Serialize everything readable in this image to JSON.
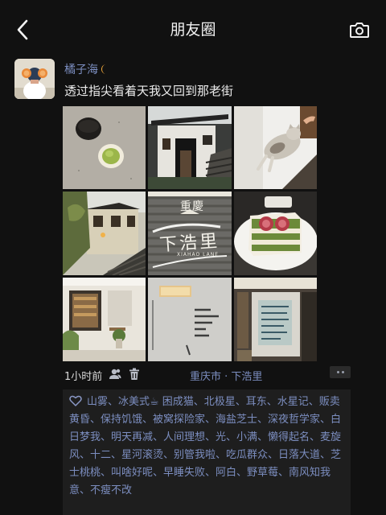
{
  "header": {
    "title": "朋友圈",
    "back_icon": "chevron-left-icon",
    "camera_icon": "camera-icon"
  },
  "post": {
    "username": "橘子海",
    "username_badge": "crescent-moon-icon",
    "text": "透过指尖看着天我又回到那老街",
    "photos": [
      "photo-stone-table-macarons",
      "photo-white-house-doorway",
      "photo-cat-on-wall",
      "photo-old-street-buildings",
      "photo-stairs-painted-sign",
      "photo-matcha-fig-cake",
      "photo-cafe-interior",
      "photo-poem-wall",
      "photo-handwritten-notice"
    ],
    "sign_text_top": "重慶",
    "sign_text_main": "下浩里",
    "sign_text_sub": "XIAHAO LANE",
    "time": "1小时前",
    "location": "重庆市 · 下浩里",
    "likes_text": "山雾、冰美式☕ 困成猫、北极星、耳东、水星记、贩卖黄昏、保持饥饿、被窝探险家、海盐芝士、深夜哲学家、白日梦我、明天再减、人间理想、光、小满、懒得起名、麦旋风、十二、星河滚烫、别管我啦、吃瓜群众、日落大道、芝士桃桃、叫啥好呢、早睡失败、阿白、野草莓、南风知我意、不瘦不改"
  },
  "colors": {
    "background": "#111111",
    "link": "#7c8ec0",
    "likes_bg": "#1e1e1e",
    "text": "#ececec"
  }
}
